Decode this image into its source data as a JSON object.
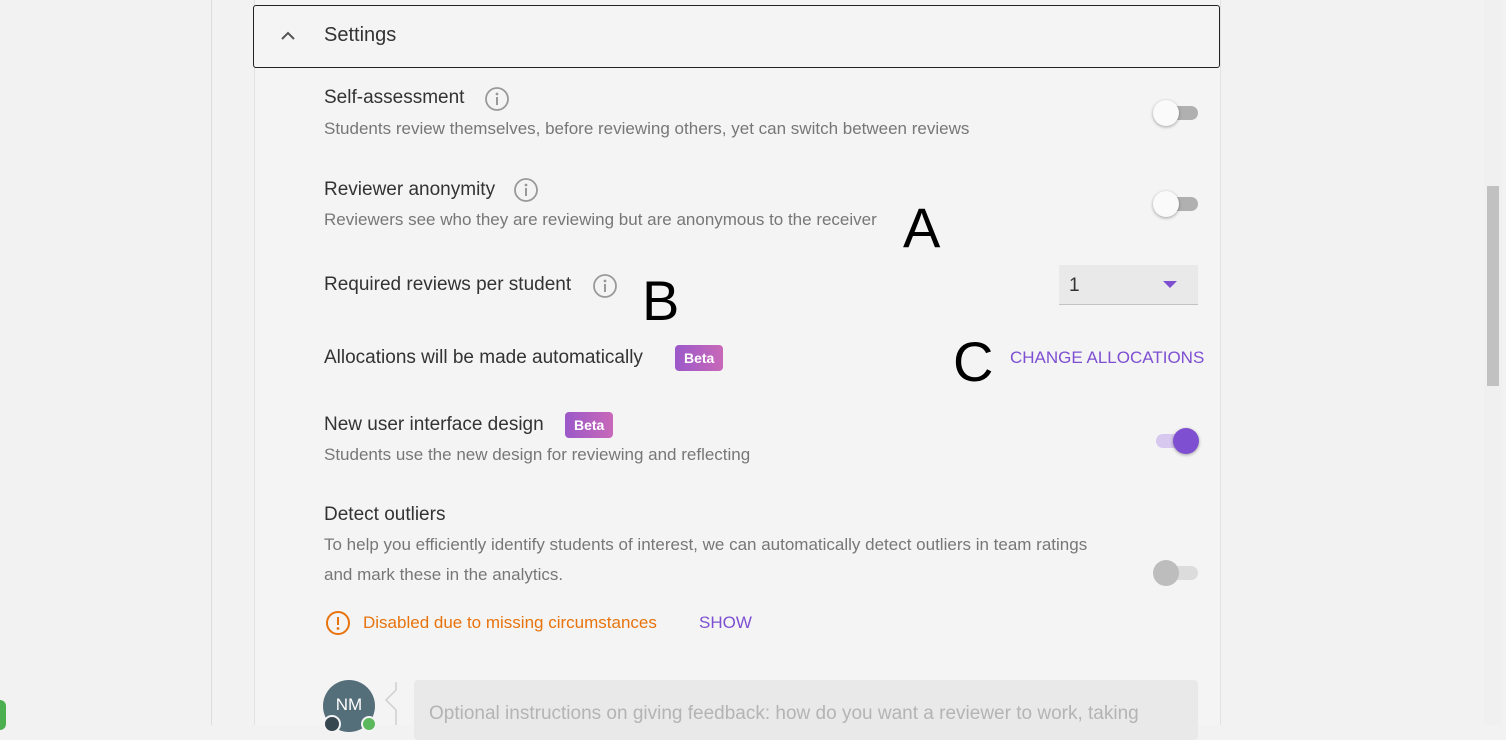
{
  "settings": {
    "title": "Settings",
    "self_assessment": {
      "title": "Self-assessment",
      "description": "Students review themselves, before reviewing others, yet can switch between reviews",
      "enabled": false
    },
    "reviewer_anonymity": {
      "title": "Reviewer anonymity",
      "description": "Reviewers see who they are reviewing but are anonymous to the receiver",
      "enabled": false
    },
    "required_reviews": {
      "title": "Required reviews per student",
      "value": "1"
    },
    "allocations": {
      "title": "Allocations will be made automatically",
      "badge": "Beta",
      "action_label": "CHANGE ALLOCATIONS"
    },
    "new_ui": {
      "title": "New user interface design",
      "badge": "Beta",
      "description": "Students use the new design for reviewing and reflecting",
      "enabled": true
    },
    "detect_outliers": {
      "title": "Detect outliers",
      "description_line1": "To help you efficiently identify students of interest, we can automatically detect outliers in team ratings",
      "description_line2": "and mark these in the analytics.",
      "enabled": false,
      "disabled": true,
      "warning": "Disabled due to missing circumstances",
      "show_label": "SHOW"
    },
    "instructions": {
      "avatar_initials": "NM",
      "placeholder": "Optional instructions on giving feedback: how do you want a reviewer to work, taking"
    }
  },
  "annotations": {
    "a": "A",
    "b": "B",
    "c": "C"
  },
  "colors": {
    "accent": "#7e4fd1",
    "warning": "#e8730c",
    "badge": "#b462c2"
  }
}
